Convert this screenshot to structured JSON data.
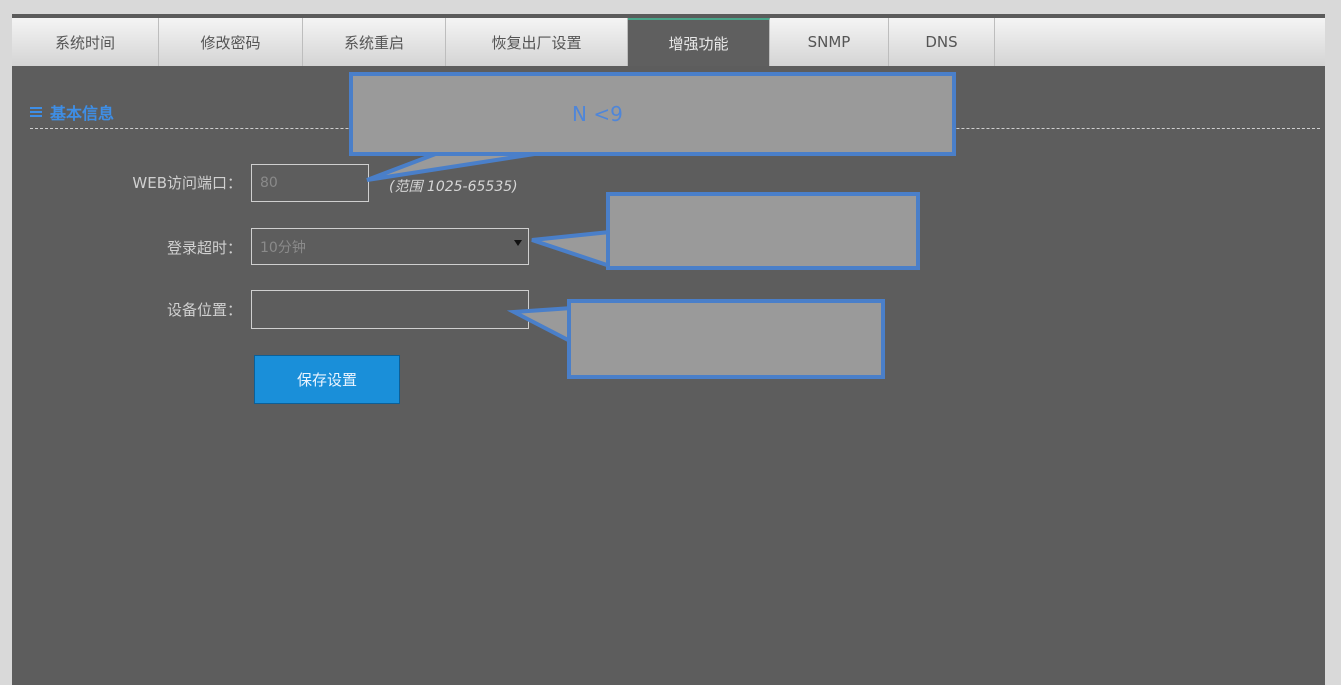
{
  "tabs": [
    {
      "label": "系统时间",
      "active": false
    },
    {
      "label": "修改密码",
      "active": false
    },
    {
      "label": "系统重启",
      "active": false
    },
    {
      "label": "恢复出厂设置",
      "active": false
    },
    {
      "label": "增强功能",
      "active": true
    },
    {
      "label": "SNMP",
      "active": false
    },
    {
      "label": "DNS",
      "active": false
    }
  ],
  "section": {
    "title": "基本信息"
  },
  "form": {
    "web_port_label": "WEB访问端口：",
    "web_port_value": "80",
    "web_port_hint": "(范围 1025-65535)",
    "login_timeout_label": "登录超时：",
    "login_timeout_value": "10分钟",
    "device_location_label": "设备位置：",
    "device_location_value": ""
  },
  "save_button": "保存设置",
  "callouts": {
    "first_text": "N <9"
  },
  "colors": {
    "accent_blue": "#3e8ee6",
    "callout_border": "#4a7fc9",
    "callout_fill": "#9a9a9a",
    "save_button": "#1a8fd9"
  }
}
